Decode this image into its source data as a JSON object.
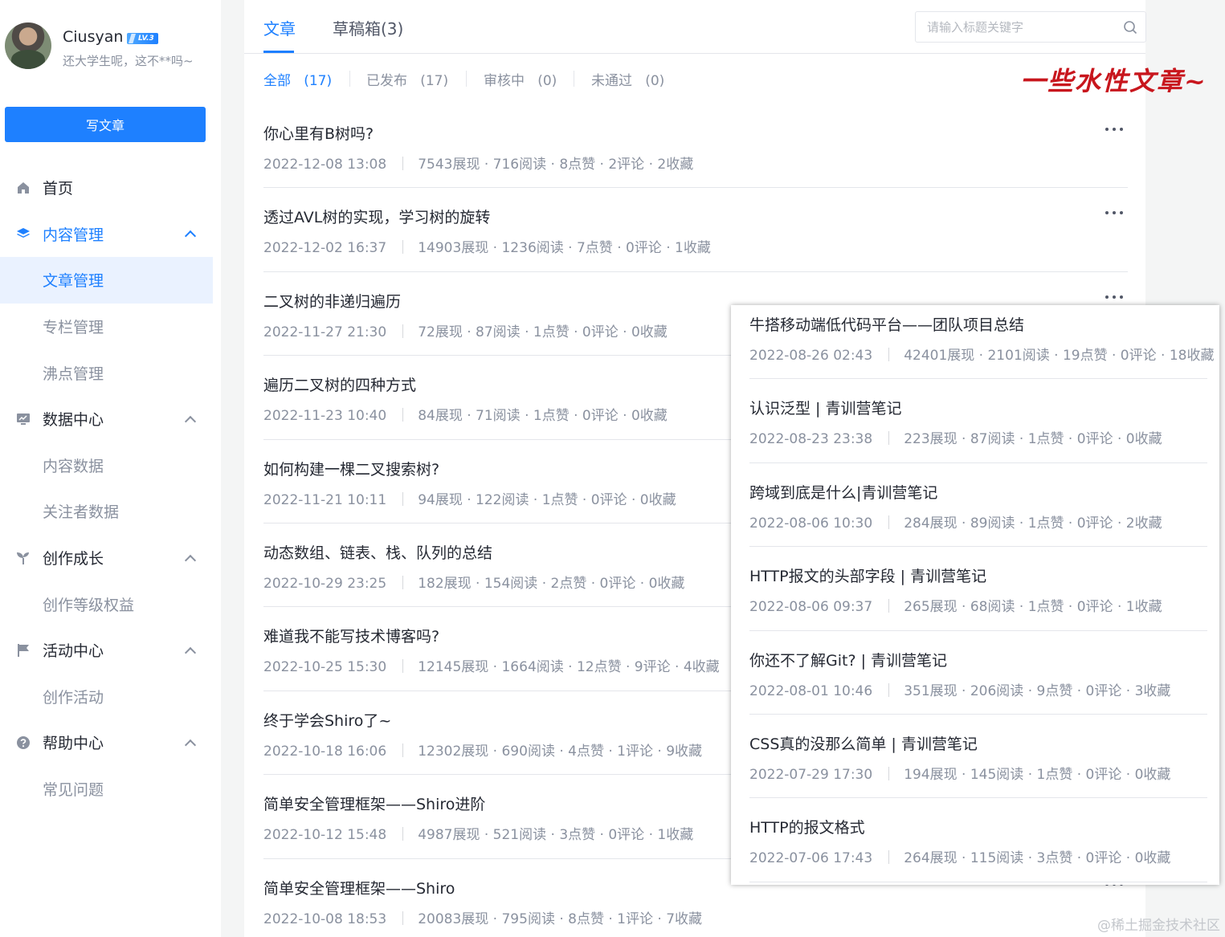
{
  "user": {
    "name": "Ciusyan",
    "level": "LV.3",
    "bio": "还大学生呢，这不**吗~"
  },
  "sidebar": {
    "write_button": "写文章",
    "items": [
      {
        "label": "首页",
        "icon": "home-icon"
      },
      {
        "label": "内容管理",
        "icon": "layers-icon"
      },
      {
        "label": "文章管理"
      },
      {
        "label": "专栏管理"
      },
      {
        "label": "沸点管理"
      },
      {
        "label": "数据中心",
        "icon": "chart-icon"
      },
      {
        "label": "内容数据"
      },
      {
        "label": "关注者数据"
      },
      {
        "label": "创作成长",
        "icon": "sprout-icon"
      },
      {
        "label": "创作等级权益"
      },
      {
        "label": "活动中心",
        "icon": "flag-icon"
      },
      {
        "label": "创作活动"
      },
      {
        "label": "帮助中心",
        "icon": "help-icon"
      },
      {
        "label": "常见问题"
      }
    ]
  },
  "header": {
    "tabs": [
      {
        "label": "文章"
      },
      {
        "label": "草稿箱(3)"
      }
    ],
    "search_placeholder": "请输入标题关键字"
  },
  "filters": [
    {
      "label": "全部",
      "count": "(17)"
    },
    {
      "label": "已发布",
      "count": "(17)"
    },
    {
      "label": "审核中",
      "count": "(0)"
    },
    {
      "label": "未通过",
      "count": "(0)"
    }
  ],
  "slogan": "一些水性文章~",
  "articles": [
    {
      "title": "你心里有B树吗?",
      "date": "2022-12-08 13:08",
      "stats": "7543展现 · 716阅读 · 8点赞 · 2评论 · 2收藏"
    },
    {
      "title": "透过AVL树的实现，学习树的旋转",
      "date": "2022-12-02 16:37",
      "stats": "14903展现 · 1236阅读 · 7点赞 · 0评论 · 1收藏"
    },
    {
      "title": "二叉树的非递归遍历",
      "date": "2022-11-27 21:30",
      "stats": "72展现 · 87阅读 · 1点赞 · 0评论 · 0收藏"
    },
    {
      "title": "遍历二叉树的四种方式",
      "date": "2022-11-23 10:40",
      "stats": "84展现 · 71阅读 · 1点赞 · 0评论 · 0收藏"
    },
    {
      "title": "如何构建一棵二叉搜索树?",
      "date": "2022-11-21 10:11",
      "stats": "94展现 · 122阅读 · 1点赞 · 0评论 · 0收藏"
    },
    {
      "title": "动态数组、链表、栈、队列的总结",
      "date": "2022-10-29 23:25",
      "stats": "182展现 · 154阅读 · 2点赞 · 0评论 · 0收藏"
    },
    {
      "title": "难道我不能写技术博客吗?",
      "date": "2022-10-25 15:30",
      "stats": "12145展现 · 1664阅读 · 12点赞 · 9评论 · 4收藏"
    },
    {
      "title": "终于学会Shiro了~",
      "date": "2022-10-18 16:06",
      "stats": "12302展现 · 690阅读 · 4点赞 · 1评论 · 9收藏"
    },
    {
      "title": "简单安全管理框架——Shiro进阶",
      "date": "2022-10-12 15:48",
      "stats": "4987展现 · 521阅读 · 3点赞 · 0评论 · 1收藏"
    },
    {
      "title": "简单安全管理框架——Shiro",
      "date": "2022-10-08 18:53",
      "stats": "20083展现 · 795阅读 · 8点赞 · 1评论 · 7收藏"
    }
  ],
  "overlay_articles": [
    {
      "title": "牛搭移动端低代码平台——团队项目总结",
      "date": "2022-08-26 02:43",
      "stats": "42401展现 · 2101阅读 · 19点赞 · 0评论 · 18收藏"
    },
    {
      "title": "认识泛型 | 青训营笔记",
      "date": "2022-08-23 23:38",
      "stats": "223展现 · 87阅读 · 1点赞 · 0评论 · 0收藏"
    },
    {
      "title": "跨域到底是什么|青训营笔记",
      "date": "2022-08-06 10:30",
      "stats": "284展现 · 89阅读 · 1点赞 · 0评论 · 2收藏"
    },
    {
      "title": "HTTP报文的头部字段 | 青训营笔记",
      "date": "2022-08-06 09:37",
      "stats": "265展现 · 68阅读 · 1点赞 · 0评论 · 1收藏"
    },
    {
      "title": "你还不了解Git? | 青训营笔记",
      "date": "2022-08-01 10:46",
      "stats": "351展现 · 206阅读 · 9点赞 · 0评论 · 3收藏"
    },
    {
      "title": "CSS真的没那么简单 | 青训营笔记",
      "date": "2022-07-29 17:30",
      "stats": "194展现 · 145阅读 · 1点赞 · 0评论 · 0收藏"
    },
    {
      "title": "HTTP的报文格式",
      "date": "2022-07-06 17:43",
      "stats": "264展现 · 115阅读 · 3点赞 · 0评论 · 0收藏"
    }
  ],
  "watermark": "@稀土掘金技术社区",
  "colors": {
    "accent": "#1e80ff",
    "slogan": "#c8161d"
  }
}
